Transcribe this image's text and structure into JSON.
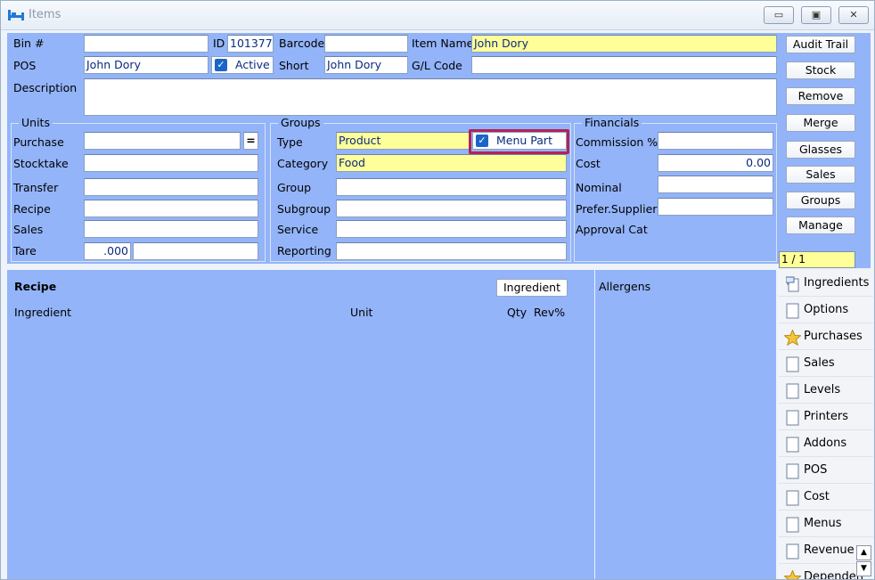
{
  "window": {
    "title": "Items"
  },
  "icons": {
    "app": "bed-icon",
    "minimize": "minimize-icon",
    "restore": "restore-icon",
    "close": "close-icon"
  },
  "colors": {
    "panel": "#93b4f9",
    "highlight_field": "#ffff99",
    "callout": "#b0245a"
  },
  "header": {
    "bin_label": "Bin #",
    "bin_value": "",
    "id_label": "ID",
    "id_value": "101377",
    "barcode_label": "Barcode",
    "barcode_value": "",
    "item_name_label": "Item Name",
    "item_name_value": "John Dory",
    "pos_label": "POS",
    "pos_value": "John Dory",
    "active_label": "Active",
    "short_label": "Short",
    "short_value": "John Dory",
    "gl_code_label": "G/L Code",
    "gl_code_value": "",
    "description_label": "Description",
    "description_value": ""
  },
  "units": {
    "title": "Units",
    "purchase_label": "Purchase",
    "purchase_value": "",
    "equals_button": "=",
    "stocktake_label": "Stocktake",
    "stocktake_value": "",
    "transfer_label": "Transfer",
    "transfer_value": "",
    "recipe_label": "Recipe",
    "recipe_value": "",
    "sales_label": "Sales",
    "sales_value": "",
    "tare_label": "Tare",
    "tare_value": ".000",
    "tare_unit": ""
  },
  "groups": {
    "title": "Groups",
    "type_label": "Type",
    "type_value": "Product",
    "menu_part_label": "Menu Part",
    "category_label": "Category",
    "category_value": "Food",
    "group_label": "Group",
    "group_value": "",
    "subgroup_label": "Subgroup",
    "subgroup_value": "",
    "service_label": "Service",
    "service_value": "",
    "reporting_label": "Reporting",
    "reporting_value": ""
  },
  "financials": {
    "title": "Financials",
    "commission_label": "Commission %",
    "commission_value": "",
    "cost_label": "Cost",
    "cost_value": "0.00",
    "nominal_label": "Nominal",
    "nominal_value": "",
    "prefer_supplier_label": "Prefer.Supplier",
    "prefer_supplier_value": "",
    "approval_cat_label": "Approval Cat"
  },
  "side_buttons": [
    "Audit Trail",
    "Stock",
    "Remove",
    "Merge",
    "Glasses",
    "Sales",
    "Groups",
    "Manage"
  ],
  "pager": "1 / 1",
  "recipe": {
    "title": "Recipe",
    "ingredient_button": "Ingredient",
    "col_ingredient": "Ingredient",
    "col_unit": "Unit",
    "col_qty": "Qty",
    "col_rev": "Rev%"
  },
  "allergens": {
    "title": "Allergens"
  },
  "tabs": [
    {
      "label": "Ingredients",
      "icon": "speech-doc-icon"
    },
    {
      "label": "Options",
      "icon": "document-icon"
    },
    {
      "label": "Purchases",
      "icon": "star-icon"
    },
    {
      "label": "Sales",
      "icon": "document-icon"
    },
    {
      "label": "Levels",
      "icon": "document-icon"
    },
    {
      "label": "Printers",
      "icon": "document-icon"
    },
    {
      "label": "Addons",
      "icon": "document-icon"
    },
    {
      "label": "POS",
      "icon": "document-icon"
    },
    {
      "label": "Cost",
      "icon": "document-icon"
    },
    {
      "label": "Menus",
      "icon": "document-icon"
    },
    {
      "label": "Revenue",
      "icon": "document-icon"
    },
    {
      "label": "Dependen",
      "icon": "star-icon"
    }
  ]
}
